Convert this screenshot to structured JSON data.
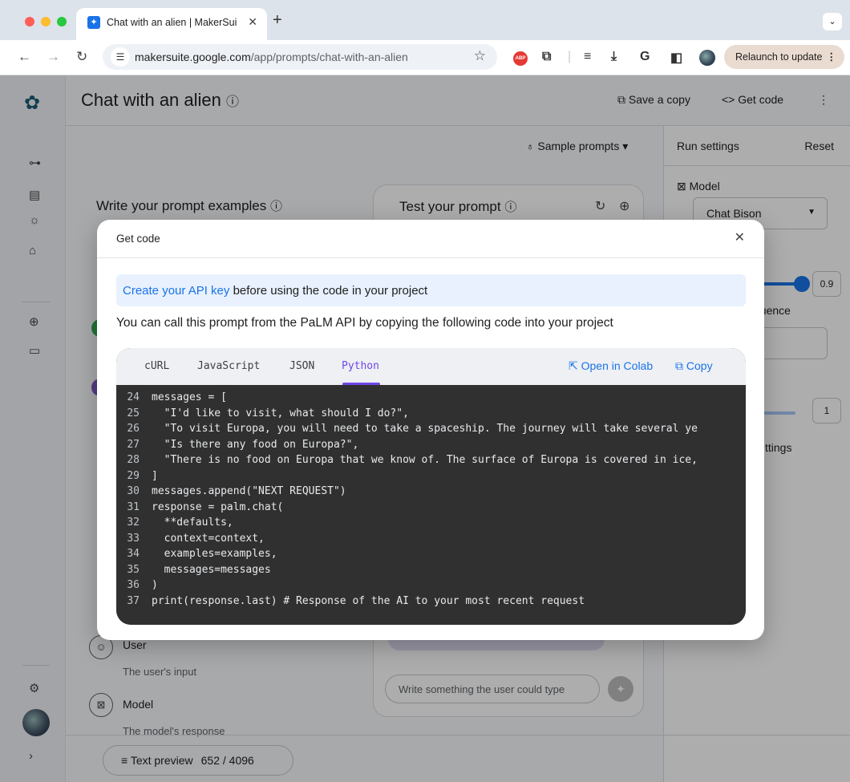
{
  "browser": {
    "tab_title": "Chat with an alien | MakerSui",
    "new_tab": "+",
    "url_host": "makersuite.google.com",
    "url_path": "/app/prompts/chat-with-an-alien",
    "relaunch": "Relaunch to update",
    "abp_label": "ABP",
    "ext_g": "G"
  },
  "header": {
    "title": "Chat with an alien",
    "save_copy": "Save a copy",
    "get_code": "Get code",
    "sample_prompts": "Sample prompts"
  },
  "run_settings": {
    "title": "Run settings",
    "reset": "Reset",
    "model_label": "Model",
    "model_value": "Chat Bison",
    "temperature_value": "0.9",
    "temperature_fraction": 0.9,
    "sequence_fragment": "quence",
    "candidates_value": "1",
    "settings_fragment": "ttings"
  },
  "editor": {
    "write_title": "Write your prompt examples",
    "test_title": "Test your prompt",
    "chat_placeholder": "Write something the user could type",
    "roles": [
      {
        "name": "User",
        "desc": "The user's input"
      },
      {
        "name": "Model",
        "desc": "The model's response"
      }
    ],
    "preview_label": "Text preview",
    "preview_count": "652 / 4096"
  },
  "modal": {
    "title": "Get code",
    "banner_link": "Create your API key",
    "banner_rest": " before using the code in your project",
    "description": "You can call this prompt from the PaLM API by copying the following code into your project",
    "tabs": [
      "cURL",
      "JavaScript",
      "JSON",
      "Python"
    ],
    "active_tab": "Python",
    "open_colab": "Open in Colab",
    "copy": "Copy",
    "code": [
      {
        "n": "24",
        "t": "messages = ["
      },
      {
        "n": "25",
        "t": "  \"I'd like to visit, what should I do?\","
      },
      {
        "n": "26",
        "t": "  \"To visit Europa, you will need to take a spaceship. The journey will take several ye"
      },
      {
        "n": "27",
        "t": "  \"Is there any food on Europa?\","
      },
      {
        "n": "28",
        "t": "  \"There is no food on Europa that we know of. The surface of Europa is covered in ice,"
      },
      {
        "n": "29",
        "t": "]"
      },
      {
        "n": "30",
        "t": "messages.append(\"NEXT REQUEST\")"
      },
      {
        "n": "31",
        "t": "response = palm.chat("
      },
      {
        "n": "32",
        "t": "  **defaults,"
      },
      {
        "n": "33",
        "t": "  context=context,"
      },
      {
        "n": "34",
        "t": "  examples=examples,"
      },
      {
        "n": "35",
        "t": "  messages=messages"
      },
      {
        "n": "36",
        "t": ")"
      },
      {
        "n": "37",
        "t": "print(response.last) # Response of the AI to your most recent request"
      }
    ]
  },
  "colors": {
    "accent": "#1a73e8",
    "tab_active": "#7048e8",
    "code_bg": "#303030",
    "banner_bg": "#e8f1fd"
  }
}
